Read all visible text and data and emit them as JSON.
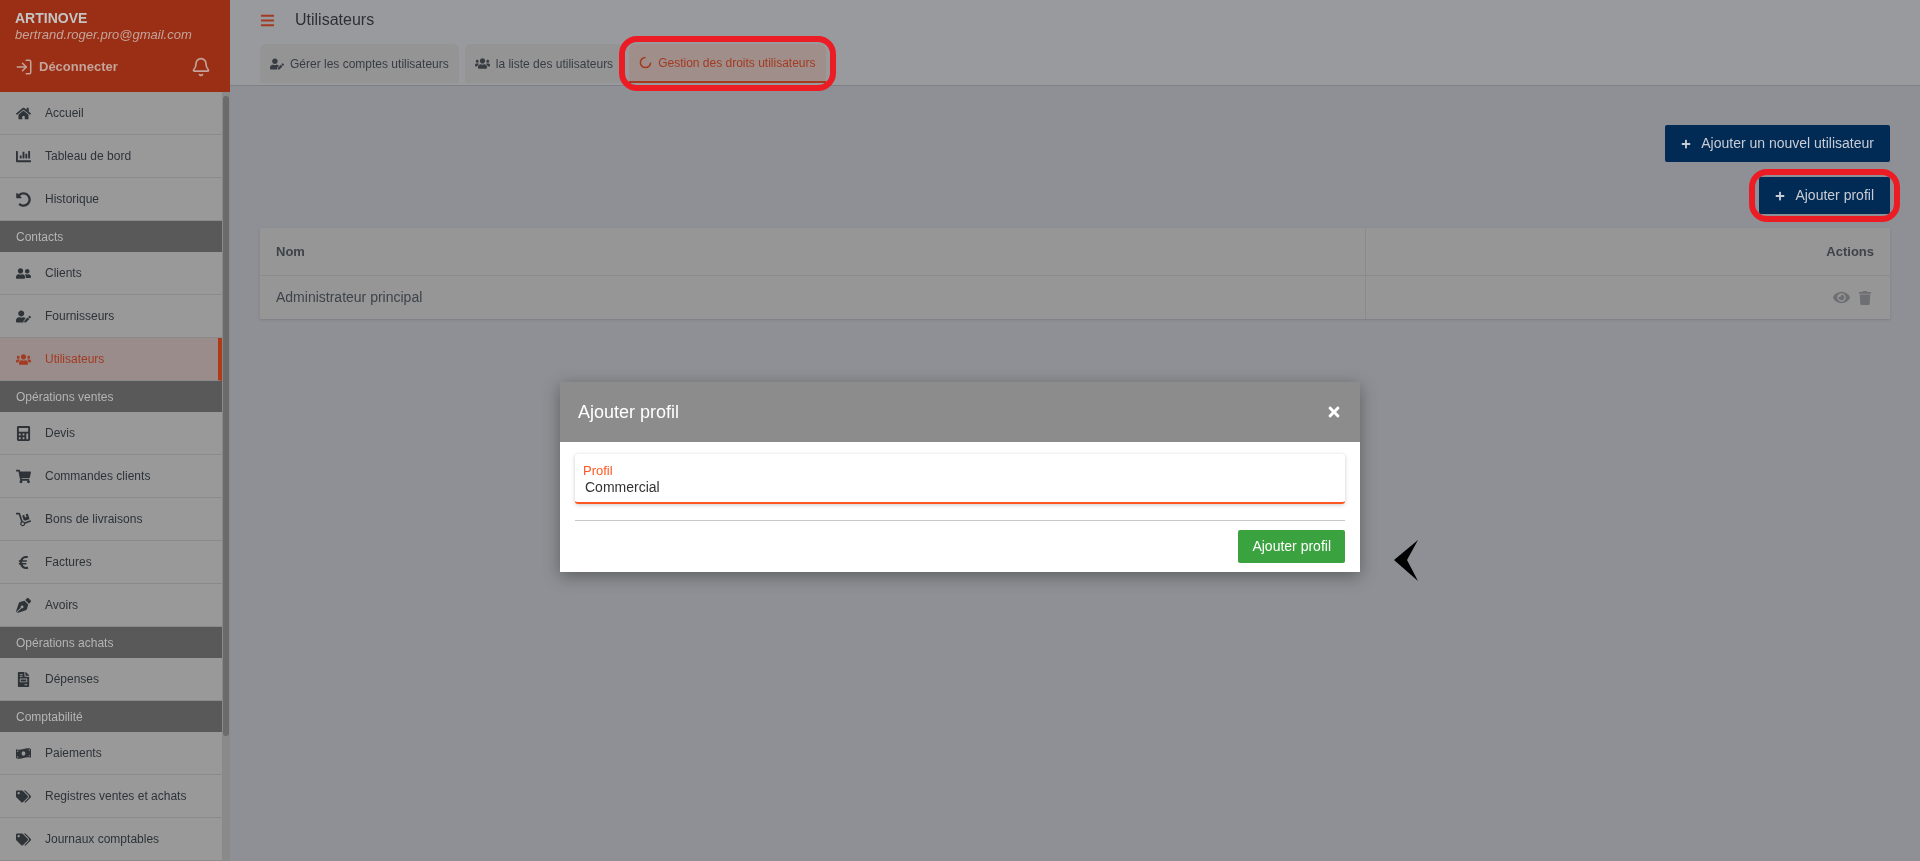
{
  "sidebar": {
    "brand": "ARTINOVE",
    "email": "bertrand.roger.pro@gmail.com",
    "logout": "Déconnecter",
    "items": [
      {
        "kind": "item",
        "label": "Accueil",
        "selected": false
      },
      {
        "kind": "item",
        "label": "Tableau de bord",
        "selected": false
      },
      {
        "kind": "item",
        "label": "Historique",
        "selected": false
      },
      {
        "kind": "section",
        "label": "Contacts"
      },
      {
        "kind": "item",
        "label": "Clients",
        "selected": false
      },
      {
        "kind": "item",
        "label": "Fournisseurs",
        "selected": false
      },
      {
        "kind": "item",
        "label": "Utilisateurs",
        "selected": true
      },
      {
        "kind": "section",
        "label": "Opérations ventes"
      },
      {
        "kind": "item",
        "label": "Devis",
        "selected": false
      },
      {
        "kind": "item",
        "label": "Commandes clients",
        "selected": false
      },
      {
        "kind": "item",
        "label": "Bons de livraisons",
        "selected": false
      },
      {
        "kind": "item",
        "label": "Factures",
        "selected": false
      },
      {
        "kind": "item",
        "label": "Avoirs",
        "selected": false
      },
      {
        "kind": "section",
        "label": "Opérations achats"
      },
      {
        "kind": "item",
        "label": "Dépenses",
        "selected": false
      },
      {
        "kind": "section",
        "label": "Comptabilité"
      },
      {
        "kind": "item",
        "label": "Paiements",
        "selected": false
      },
      {
        "kind": "item",
        "label": "Registres ventes et achats",
        "selected": false
      },
      {
        "kind": "item",
        "label": "Journaux comptables",
        "selected": false
      }
    ]
  },
  "page": {
    "title": "Utilisateurs",
    "tabs": [
      {
        "label": "Gérer les comptes utilisateurs",
        "selected": false,
        "highlighted": false
      },
      {
        "label": "la liste des utilisateurs",
        "selected": false,
        "highlighted": false
      },
      {
        "label": "Gestion des droits utilisateurs",
        "selected": true,
        "highlighted": true
      }
    ],
    "buttons": [
      {
        "label": "Ajouter un nouvel utilisateur",
        "highlighted": false
      },
      {
        "label": "Ajouter profil",
        "highlighted": true
      }
    ],
    "table": {
      "columns": [
        "Nom",
        "Actions"
      ],
      "rows": [
        {
          "name": "Administrateur principal"
        }
      ]
    }
  },
  "dialog": {
    "title": "Ajouter profil",
    "field": {
      "label": "Profil",
      "value": "Commercial"
    },
    "submit": "Ajouter profil"
  }
}
